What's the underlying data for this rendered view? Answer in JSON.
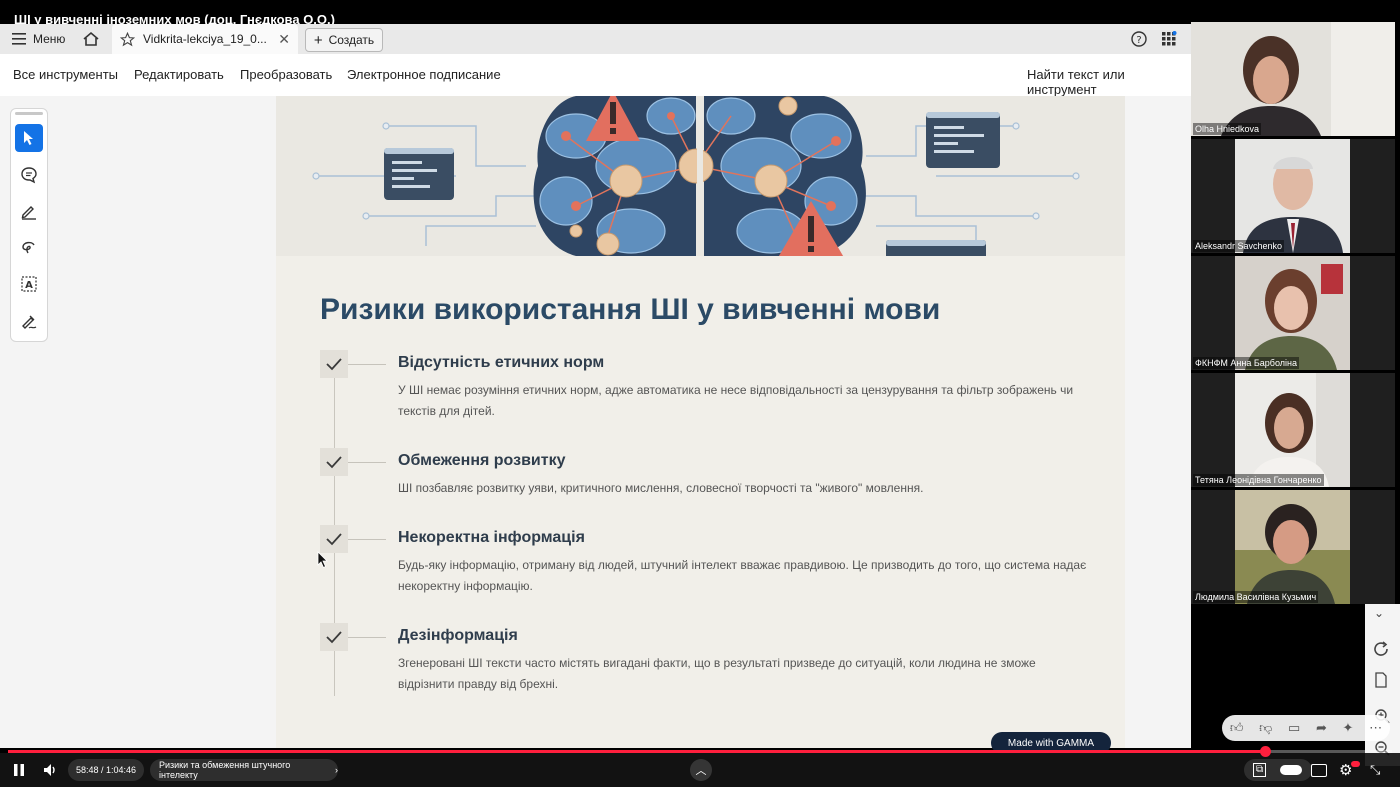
{
  "video": {
    "title": "ШІ у вивченні іноземних мов (доц. Гнєдкова О.О.)",
    "time": "58:48 / 1:04:46",
    "chapter": "Ризики та обмеження штучного інтелекту",
    "progress": 0.908
  },
  "acrobat": {
    "menu_label": "Меню",
    "tab_label": "Vidkrita-lekciya_19_0...",
    "create_label": "Создать",
    "menubar": {
      "all_tools": "Все инструменты",
      "edit": "Редактировать",
      "convert": "Преобразовать",
      "e_sign": "Электронное подписание",
      "find": "Найти текст или инструмент"
    }
  },
  "slide": {
    "title": "Ризики використання ШІ у вивченні мови",
    "items": [
      {
        "title": "Відсутність етичних норм",
        "desc": "У ШІ немає розуміння етичних норм, адже автоматика не несе відповідальності за цензурування та фільтр зображень чи текстів для дітей."
      },
      {
        "title": "Обмеження розвитку",
        "desc": "ШІ позбавляє розвитку уяви, критичного мислення, словесної творчості та \"живого\" мовлення."
      },
      {
        "title": "Некоректна інформація",
        "desc": "Будь-яку інформацію, отриману від людей, штучний інтелект вважає правдивою. Це призводить до того, що система надає некоректну інформацію."
      },
      {
        "title": "Дезінформація",
        "desc": "Згенеровані ШІ тексти часто містять вигадані факти, що в результаті призведе до ситуацій, коли людина не зможе відрізнити правду від брехні."
      }
    ],
    "badge": "Made with GAMMA"
  },
  "participants": [
    {
      "name": "Olha Hniedkova"
    },
    {
      "name": "Aleksandr Savchenko"
    },
    {
      "name": "ФКНФМ Анна Барболіна"
    },
    {
      "name": "Тетяна Леонідівна Гончаренко"
    },
    {
      "name": "Людмила Василівна Кузьмич"
    }
  ],
  "colors": {
    "accent_red": "#ff1f3d",
    "slide_title": "#2b4a66",
    "slide_bg": "#f1efe9",
    "acrobat_blue": "#1473e6"
  }
}
